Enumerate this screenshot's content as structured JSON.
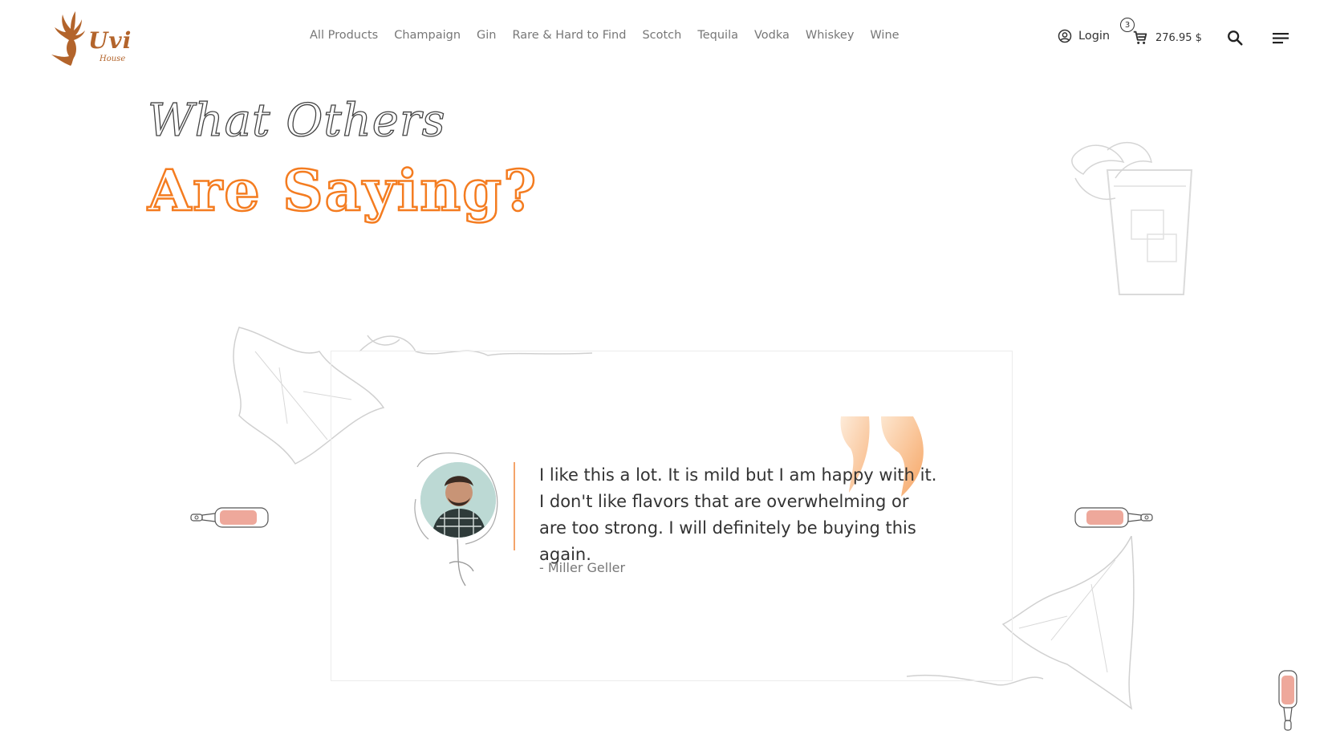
{
  "brand": {
    "name": "Uvi",
    "tagline": "House",
    "color": "#b3642b"
  },
  "nav": {
    "items": [
      {
        "label": "All Products"
      },
      {
        "label": "Champaign"
      },
      {
        "label": "Gin"
      },
      {
        "label": "Rare & Hard to Find"
      },
      {
        "label": "Scotch"
      },
      {
        "label": "Tequila"
      },
      {
        "label": "Vodka"
      },
      {
        "label": "Whiskey"
      },
      {
        "label": "Wine"
      }
    ]
  },
  "account": {
    "login_label": "Login",
    "icon": "user-circle-icon"
  },
  "cart": {
    "count": "3",
    "total": "276.95 $",
    "icon": "cart-icon"
  },
  "icons": {
    "search": "search-icon",
    "menu": "menu-icon"
  },
  "section": {
    "script_title": "What Others",
    "main_title": "Are Saying?",
    "accent_color": "#f47c20"
  },
  "testimonial": {
    "quote": "I like this a lot. It is mild but I am happy with it. I don't like flavors that are overwhelming or are too strong. I will definitely be buying this again.",
    "author": "- Miller Geller"
  }
}
